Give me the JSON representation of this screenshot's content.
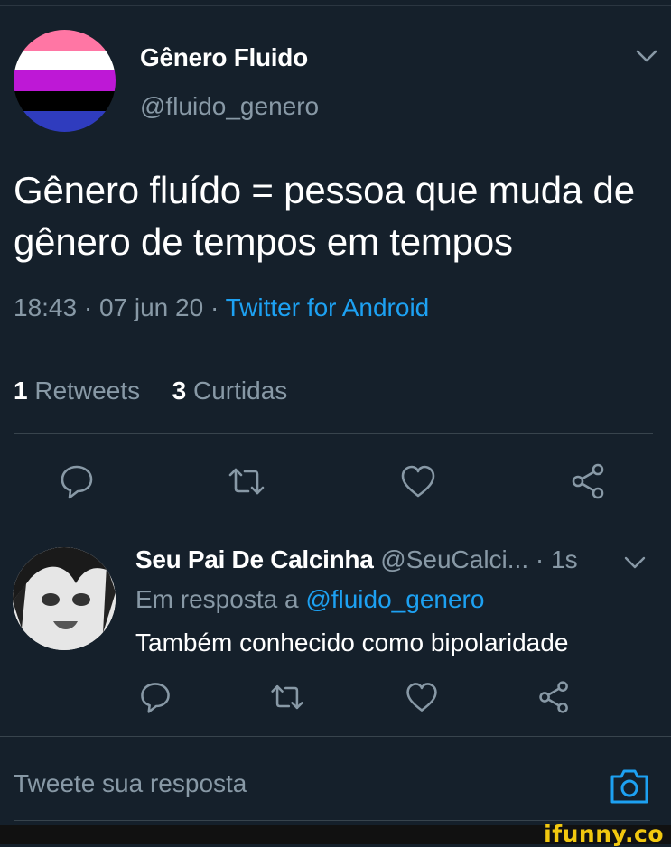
{
  "tweet": {
    "author_name": "Gênero Fluido",
    "author_handle": "@fluido_genero",
    "text": "Gênero fluído = pessoa que muda de gênero de tempos em tempos",
    "time": "18:43",
    "date": "07 jun 20",
    "source": "Twitter for Android",
    "retweet_count": "1",
    "retweet_label": "Retweets",
    "like_count": "3",
    "like_label": "Curtidas",
    "avatar_colors": [
      "#ff76a4",
      "#ffffff",
      "#be18d6",
      "#000000",
      "#2f3cbe"
    ]
  },
  "reply": {
    "author_name": "Seu Pai De Calcinha",
    "author_handle": "@SeuCalci...",
    "time": "1s",
    "reply_to_prefix": "Em resposta a",
    "reply_to_handle": "@fluido_genero",
    "text": "Também conhecido como bipolaridade"
  },
  "composer": {
    "placeholder": "Tweete sua resposta"
  },
  "watermark": "ifunny.co",
  "theme": {
    "background": "#15202b",
    "accent": "#1da1f2",
    "muted": "#8899a6"
  }
}
